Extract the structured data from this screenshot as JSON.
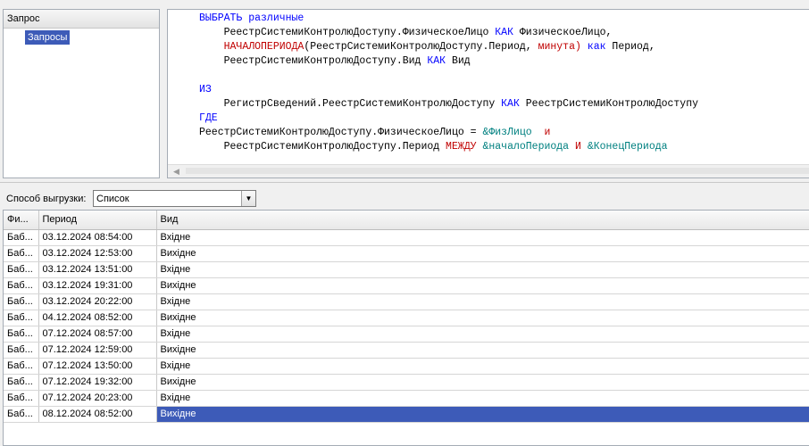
{
  "tree": {
    "header": "Запрос",
    "items": [
      {
        "label": "Запросы"
      }
    ]
  },
  "query": {
    "lines": [
      [
        {
          "t": "ВЫБРАТЬ различные",
          "c": "kw"
        }
      ],
      [
        {
          "t": "    РеестрСистемиКонтролюДоступу.ФизическоеЛицо "
        },
        {
          "t": "КАК",
          "c": "kw"
        },
        {
          "t": " ФизическоеЛицо,"
        }
      ],
      [
        {
          "t": "    "
        },
        {
          "t": "НАЧАЛОПЕРИОДА",
          "c": "fn"
        },
        {
          "t": "(РеестрСистемиКонтролюДоступу.Период, "
        },
        {
          "t": "минута)",
          "c": "fn"
        },
        {
          "t": " "
        },
        {
          "t": "как",
          "c": "kw"
        },
        {
          "t": " Период,"
        }
      ],
      [
        {
          "t": "    РеестрСистемиКонтролюДоступу.Вид "
        },
        {
          "t": "КАК",
          "c": "kw"
        },
        {
          "t": " Вид"
        }
      ],
      [
        {
          "t": ""
        }
      ],
      [
        {
          "t": "ИЗ",
          "c": "kw"
        }
      ],
      [
        {
          "t": "    РегистрСведений.РеестрСистемиКонтролюДоступу "
        },
        {
          "t": "КАК",
          "c": "kw"
        },
        {
          "t": " РеестрСистемиКонтролюДоступу"
        }
      ],
      [
        {
          "t": "ГДЕ",
          "c": "kw"
        }
      ],
      [
        {
          "t": "РеестрСистемиКонтролюДоступу.ФизическоеЛицо = "
        },
        {
          "t": "&ФизЛицо",
          "c": "prm"
        },
        {
          "t": "  "
        },
        {
          "t": "и",
          "c": "fn"
        }
      ],
      [
        {
          "t": "    РеестрСистемиКонтролюДоступу.Период "
        },
        {
          "t": "МЕЖДУ",
          "c": "fn"
        },
        {
          "t": " "
        },
        {
          "t": "&началоПериода",
          "c": "prm"
        },
        {
          "t": " "
        },
        {
          "t": "И",
          "c": "fn"
        },
        {
          "t": " "
        },
        {
          "t": "&КонецПериода",
          "c": "prm"
        }
      ]
    ]
  },
  "export": {
    "label": "Способ выгрузки:",
    "value": "Список"
  },
  "grid": {
    "columns": [
      "Фи...",
      "Период",
      "Вид"
    ],
    "rows": [
      [
        "Баб...",
        "03.12.2024 08:54:00",
        "Вхідне"
      ],
      [
        "Баб...",
        "03.12.2024 12:53:00",
        "Вихідне"
      ],
      [
        "Баб...",
        "03.12.2024 13:51:00",
        "Вхідне"
      ],
      [
        "Баб...",
        "03.12.2024 19:31:00",
        "Вихідне"
      ],
      [
        "Баб...",
        "03.12.2024 20:22:00",
        "Вхідне"
      ],
      [
        "Баб...",
        "04.12.2024 08:52:00",
        "Вихідне"
      ],
      [
        "Баб...",
        "07.12.2024 08:57:00",
        "Вхідне"
      ],
      [
        "Баб...",
        "07.12.2024 12:59:00",
        "Вихідне"
      ],
      [
        "Баб...",
        "07.12.2024 13:50:00",
        "Вхідне"
      ],
      [
        "Баб...",
        "07.12.2024 19:32:00",
        "Вихідне"
      ],
      [
        "Баб...",
        "07.12.2024 20:23:00",
        "Вхідне"
      ],
      [
        "Баб...",
        "08.12.2024 08:52:00",
        "Вихідне"
      ]
    ],
    "selected_row": 11,
    "selection_color": "#3d5bb8"
  }
}
